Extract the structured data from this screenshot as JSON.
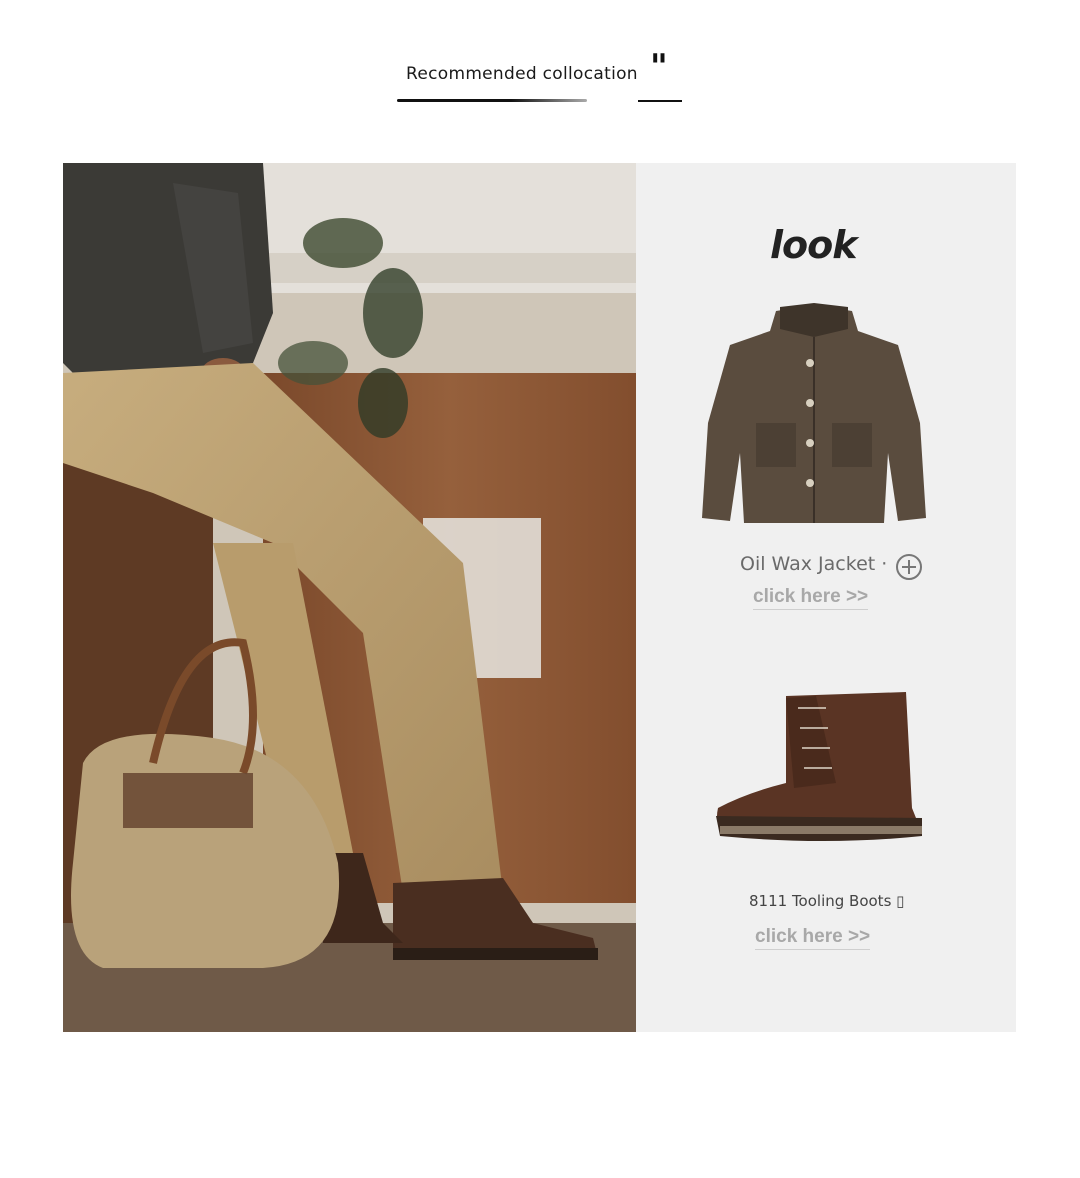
{
  "header": {
    "title": "Recommended collocation",
    "quote_mark": "\""
  },
  "look": {
    "title": "look",
    "products": [
      {
        "name": "Oil Wax Jacket ·",
        "link": "click here >>",
        "image_icon": "jacket-image",
        "action_icon": "add-circle-icon"
      },
      {
        "name": "8111 Tooling Boots ▯",
        "link": "click here >>",
        "image_icon": "boot-image"
      }
    ]
  },
  "photo": {
    "icon": "model-photo"
  }
}
